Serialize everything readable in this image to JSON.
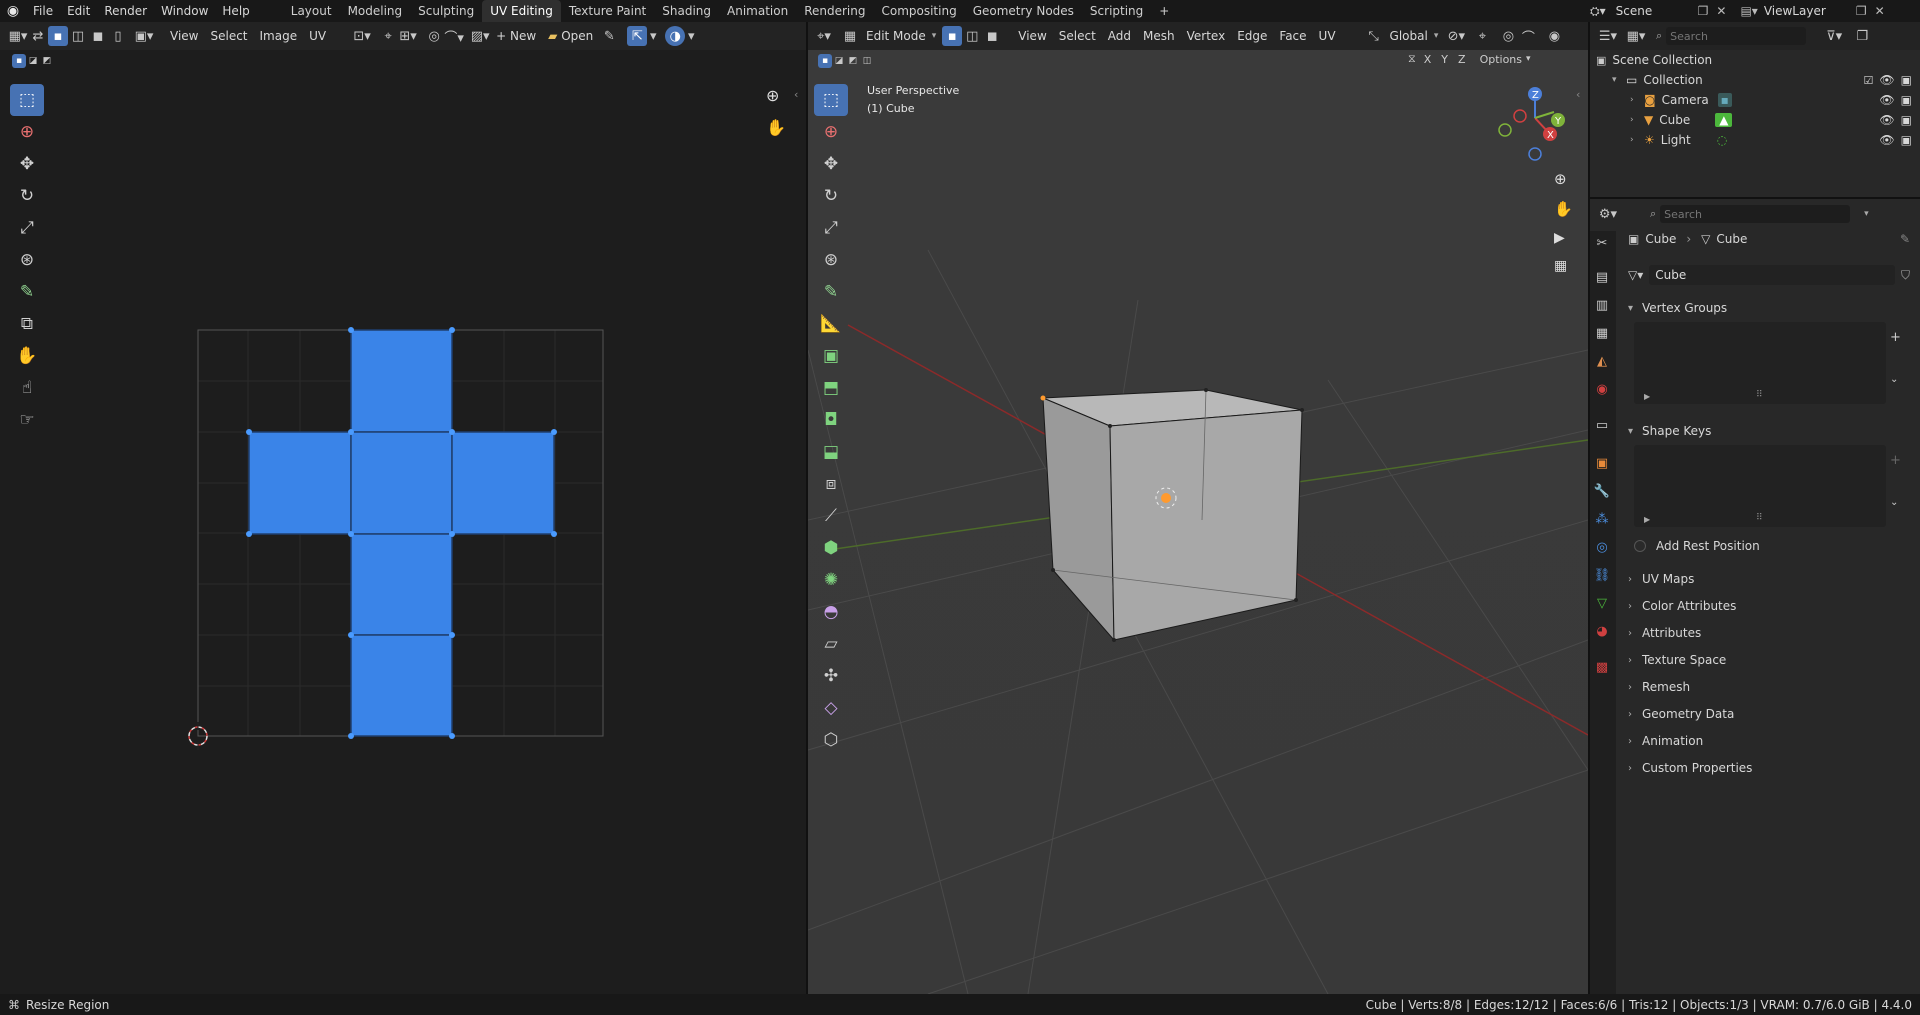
{
  "topbar": {
    "menus": [
      "File",
      "Edit",
      "Render",
      "Window",
      "Help"
    ],
    "workspaces": [
      "Layout",
      "Modeling",
      "Sculpting",
      "UV Editing",
      "Texture Paint",
      "Shading",
      "Animation",
      "Rendering",
      "Compositing",
      "Geometry Nodes",
      "Scripting"
    ],
    "active_workspace": "UV Editing",
    "add_tab": "+",
    "scene": "Scene",
    "view_layer": "ViewLayer"
  },
  "uv_editor": {
    "menus": [
      "View",
      "Select",
      "Image",
      "UV"
    ],
    "new_label": "New",
    "open_label": "Open"
  },
  "viewport": {
    "mode": "Edit Mode",
    "menus": [
      "View",
      "Select",
      "Add",
      "Mesh",
      "Vertex",
      "Edge",
      "Face",
      "UV"
    ],
    "orientation": "Global",
    "axes": [
      "X",
      "Y",
      "Z"
    ],
    "options_label": "Options",
    "view_name": "User Perspective",
    "object_name": "(1) Cube"
  },
  "outliner": {
    "search_placeholder": "Search",
    "scene_collection": "Scene Collection",
    "collection": "Collection",
    "items": [
      "Camera",
      "Cube",
      "Light"
    ]
  },
  "properties": {
    "search_placeholder": "Search",
    "breadcrumb_object": "Cube",
    "breadcrumb_data": "Cube",
    "mesh_name": "Cube",
    "panels_open": [
      "Vertex Groups",
      "Shape Keys"
    ],
    "add_rest_position": "Add Rest Position",
    "panels_closed": [
      "UV Maps",
      "Color Attributes",
      "Attributes",
      "Texture Space",
      "Remesh",
      "Geometry Data",
      "Animation",
      "Custom Properties"
    ]
  },
  "statusbar": {
    "left": "Resize Region",
    "right": "Cube | Verts:8/8 | Edges:12/12 | Faces:6/6 | Tris:12 | Objects:1/3 | VRAM: 0.7/6.0 GiB | 4.4.0"
  },
  "colors": {
    "accent": "#4772b3",
    "uv_face": "#3a84e8",
    "grid_red": "#8b2a2a",
    "grid_green": "#4d6b2a"
  }
}
